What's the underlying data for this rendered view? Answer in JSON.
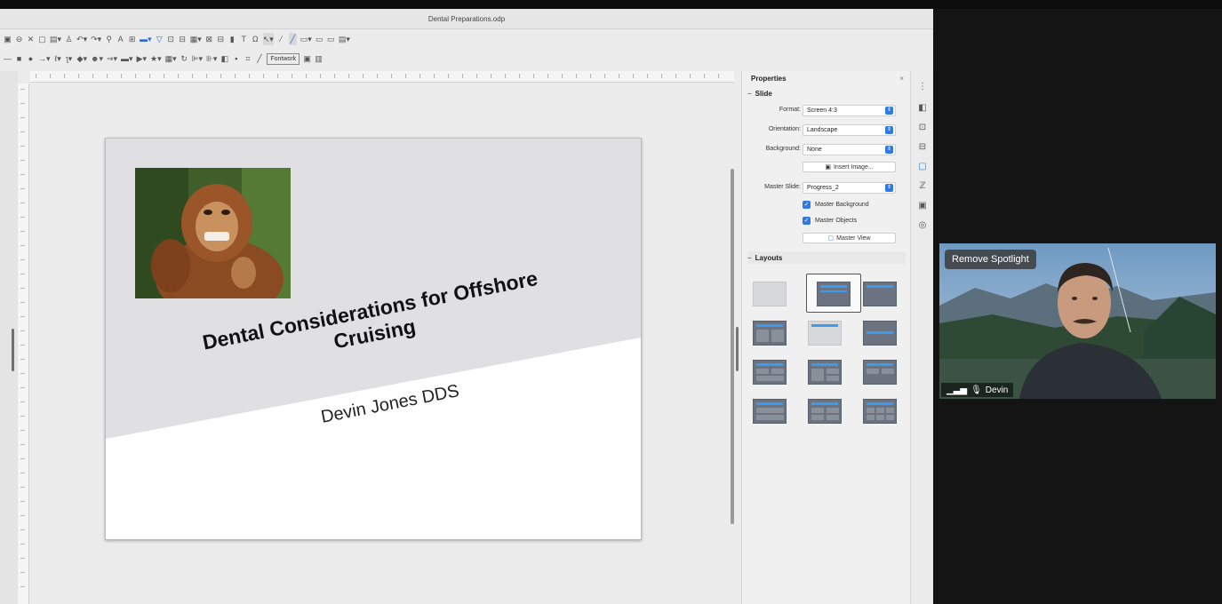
{
  "window": {
    "title": "Dental Preparations.odp"
  },
  "toolbar": {
    "fontwork_label": "Fontwork"
  },
  "slide": {
    "title_line1": "Dental Considerations for Offshore",
    "title_line2": "Cruising",
    "subtitle": "Devin Jones DDS"
  },
  "sidebar": {
    "title": "Properties",
    "close_glyph": "×",
    "slide_section": "Slide",
    "format_label": "Format:",
    "format_value": "Screen 4:3",
    "orientation_label": "Orientation:",
    "orientation_value": "Landscape",
    "background_label": "Background:",
    "background_value": "None",
    "insert_image_label": "Insert Image...",
    "master_slide_label": "Master Slide:",
    "master_slide_value": "Progress_2",
    "master_background_label": "Master Background",
    "master_objects_label": "Master Objects",
    "master_view_label": "Master View",
    "layouts_section": "Layouts"
  },
  "video": {
    "spotlight_label": "Remove Spotlight",
    "participant_name": "Devin"
  },
  "colors": {
    "accent": "#2f7ae5",
    "slide_band": "#e0e0e2",
    "layout_bar": "#3a9bf0"
  },
  "icons": [
    "new-icon",
    "save-icon",
    "cut-icon",
    "copy-icon",
    "paste-icon",
    "clone-icon",
    "undo-icon",
    "redo-icon",
    "find-icon",
    "spelling-icon",
    "grid-icon",
    "display-icon",
    "shapes-icon",
    "new-slide-icon",
    "duplicate-slide-icon",
    "slide-layout-icon",
    "image-icon",
    "table-icon",
    "chart-icon",
    "textbox-icon",
    "special-char-icon",
    "select-icon",
    "line-icon",
    "fontwork-icon",
    "properties-deck-icon",
    "slide-transition-icon",
    "animation-icon",
    "master-slides-icon",
    "styles-icon",
    "gallery-icon",
    "navigator-icon",
    "signal-icon",
    "mic-icon"
  ]
}
